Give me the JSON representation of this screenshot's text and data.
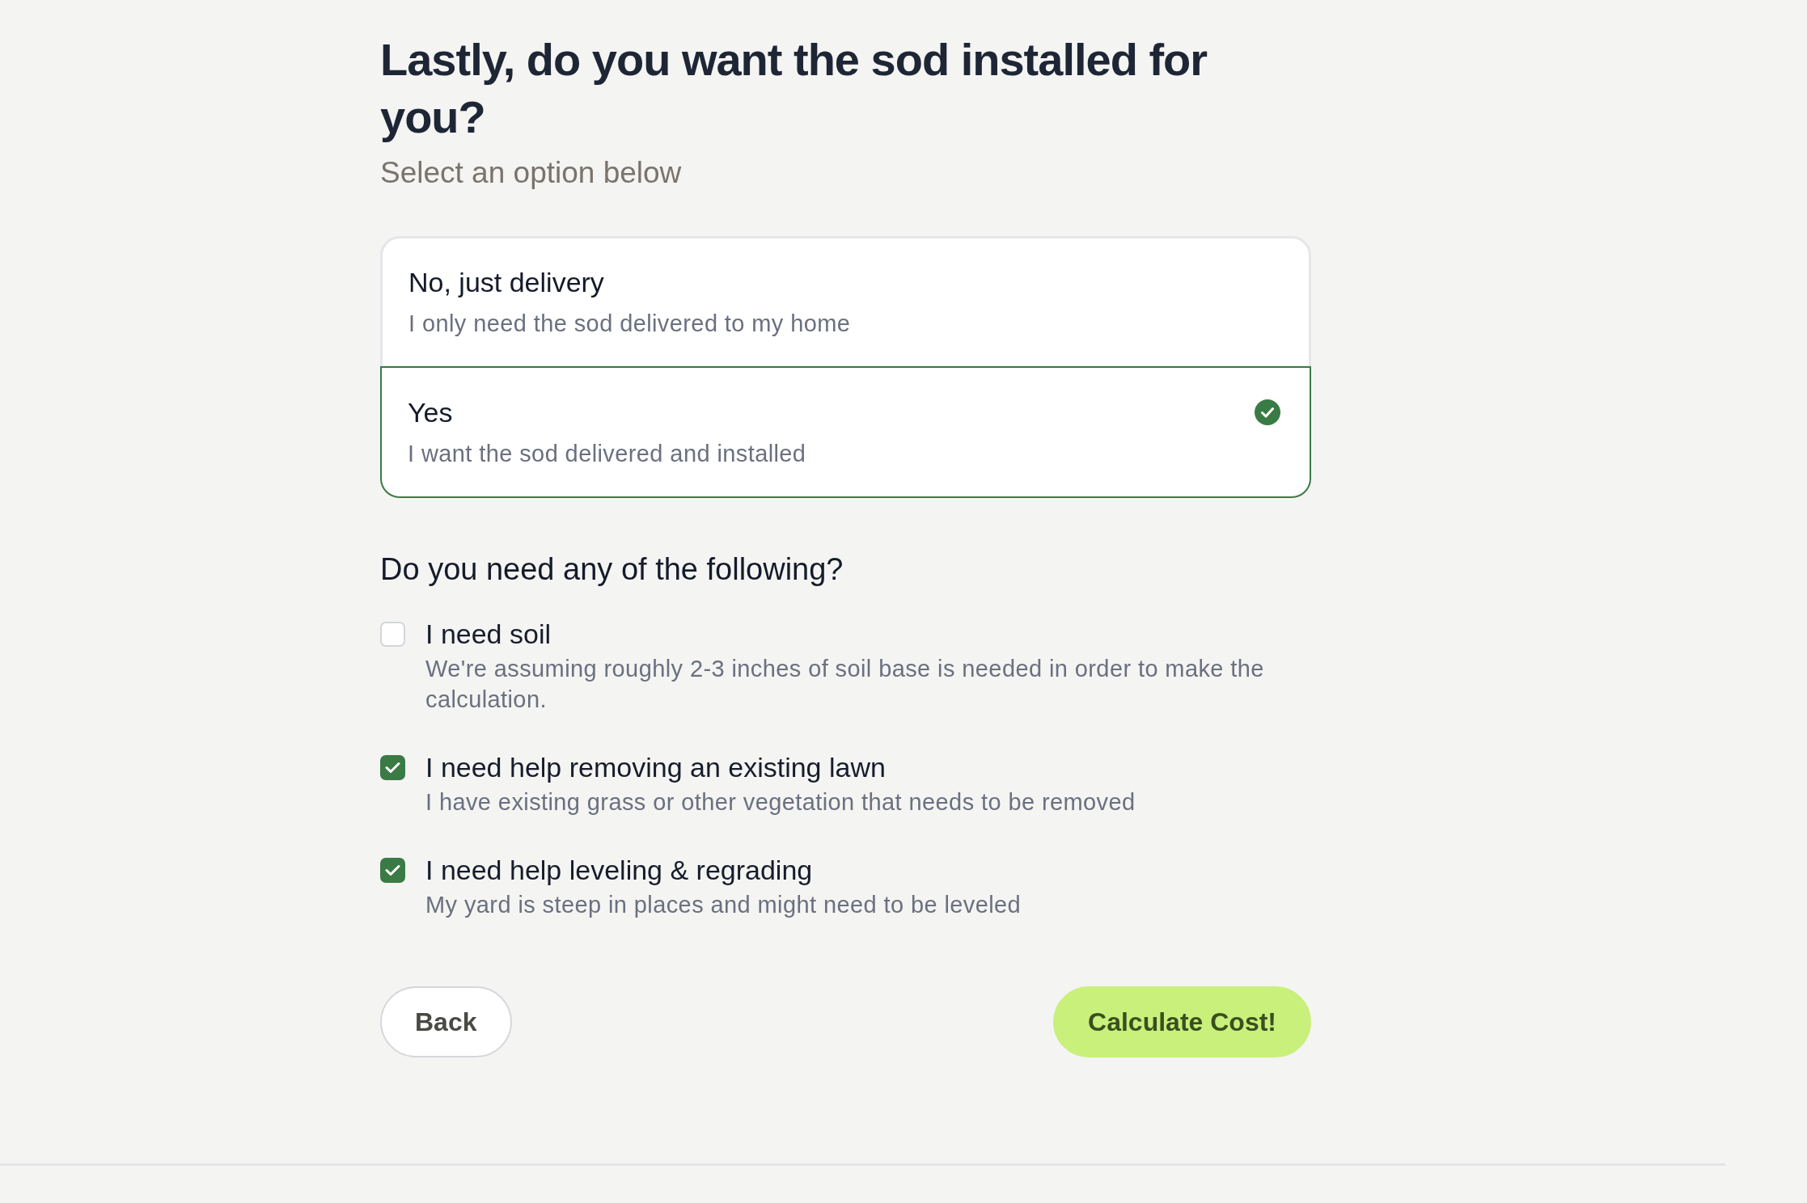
{
  "heading": "Lastly, do you want the sod installed for you?",
  "subheading": "Select an option below",
  "options": [
    {
      "title": "No, just delivery",
      "description": "I only need the sod delivered to my home",
      "selected": false
    },
    {
      "title": "Yes",
      "description": "I want the sod delivered and installed",
      "selected": true
    }
  ],
  "extras": {
    "title": "Do you need any of the following?",
    "items": [
      {
        "label": "I need soil",
        "description": "We're assuming roughly 2-3 inches of soil base is needed in order to make the calculation.",
        "checked": false
      },
      {
        "label": "I need help removing an existing lawn",
        "description": "I have existing grass or other vegetation that needs to be removed",
        "checked": true
      },
      {
        "label": "I need help leveling & regrading",
        "description": "My yard is steep in places and might need to be leveled",
        "checked": true
      }
    ]
  },
  "buttons": {
    "back": "Back",
    "submit": "Calculate Cost!"
  }
}
